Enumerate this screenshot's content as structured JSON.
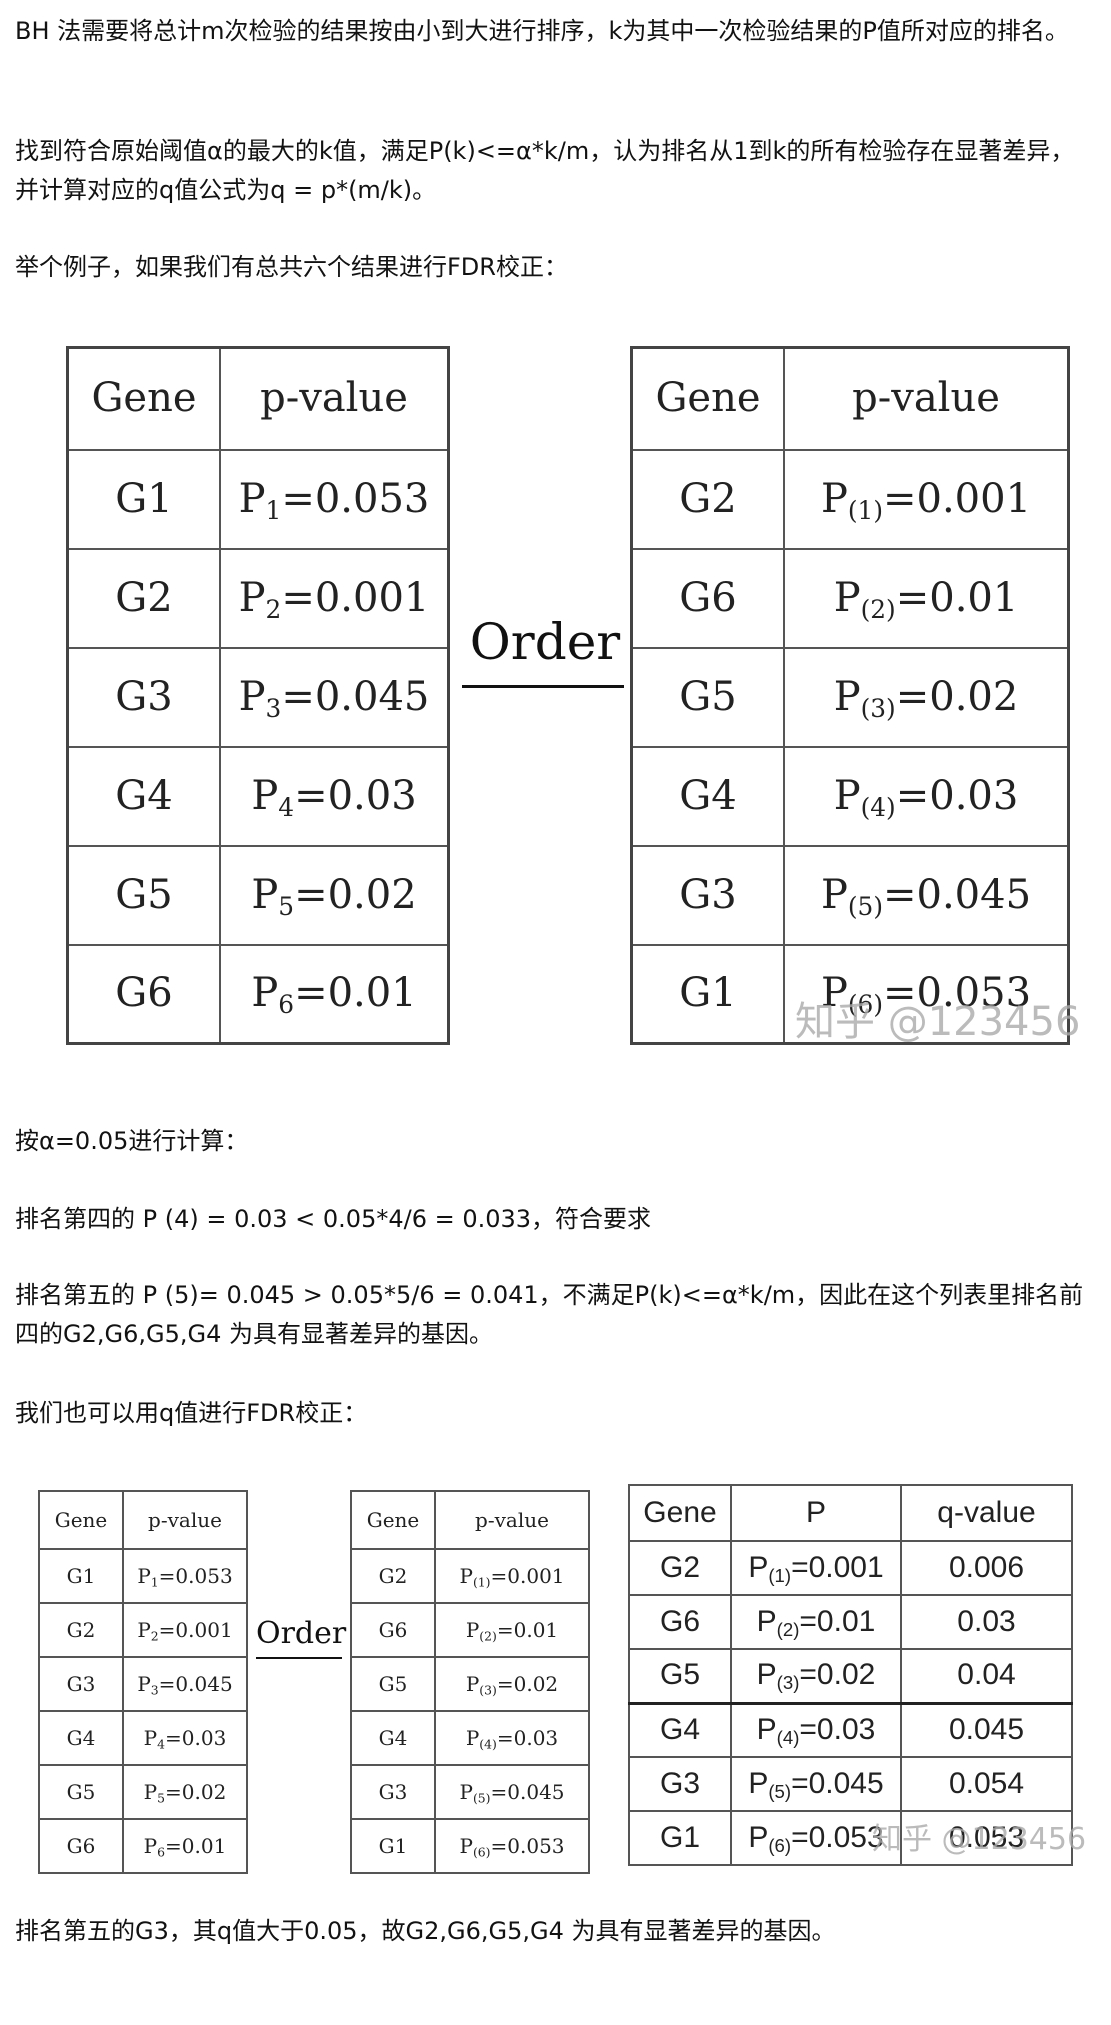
{
  "paragraphs": {
    "p1": "BH 法需要将总计m次检验的结果按由小到大进行排序，k为其中一次检验结果的P值所对应的排名。",
    "p2": "找到符合原始阈值α的最大的k值，满足P(k)<=α*k/m，认为排名从1到k的所有检验存在显著差异，并计算对应的q值公式为q = p*(m/k)。",
    "p3": "举个例子，如果我们有总共六个结果进行FDR校正：",
    "p4": "按α=0.05进行计算：",
    "p5": "排名第四的 P (4) = 0.03 < 0.05*4/6 = 0.033，符合要求",
    "p6": "排名第五的 P (5)= 0.045 > 0.05*5/6 = 0.041，不满足P(k)<=α*k/m，因此在这个列表里排名前四的G2,G6,G5,G4 为具有显著差异的基因。",
    "p7": "我们也可以用q值进行FDR校正：",
    "p8": "排名第五的G3，其q值大于0.05，故G2,G6,G5,G4 为具有显著差异的基因。"
  },
  "figure1": {
    "order_label": "Order",
    "watermark": "知乎 @123456",
    "original": {
      "headers": [
        "Gene",
        "p-value"
      ],
      "rows": [
        {
          "gene": "G1",
          "p": "P",
          "sub": "1",
          "value": "=0.053"
        },
        {
          "gene": "G2",
          "p": "P",
          "sub": "2",
          "value": "=0.001"
        },
        {
          "gene": "G3",
          "p": "P",
          "sub": "3",
          "value": "=0.045"
        },
        {
          "gene": "G4",
          "p": "P",
          "sub": "4",
          "value": "=0.03"
        },
        {
          "gene": "G5",
          "p": "P",
          "sub": "5",
          "value": "=0.02"
        },
        {
          "gene": "G6",
          "p": "P",
          "sub": "6",
          "value": "=0.01"
        }
      ]
    },
    "ordered": {
      "headers": [
        "Gene",
        "p-value"
      ],
      "rows": [
        {
          "gene": "G2",
          "p": "P",
          "sub": "(1)",
          "value": "=0.001"
        },
        {
          "gene": "G6",
          "p": "P",
          "sub": "(2)",
          "value": "=0.01"
        },
        {
          "gene": "G5",
          "p": "P",
          "sub": "(3)",
          "value": "=0.02"
        },
        {
          "gene": "G4",
          "p": "P",
          "sub": "(4)",
          "value": "=0.03"
        },
        {
          "gene": "G3",
          "p": "P",
          "sub": "(5)",
          "value": "=0.045"
        },
        {
          "gene": "G1",
          "p": "P",
          "sub": "(6)",
          "value": "=0.053"
        }
      ]
    }
  },
  "figure2": {
    "order_label": "Order",
    "watermark": "知乎 @123456",
    "original": {
      "headers": [
        "Gene",
        "p-value"
      ],
      "rows": [
        {
          "gene": "G1",
          "p": "P",
          "sub": "1",
          "value": "=0.053"
        },
        {
          "gene": "G2",
          "p": "P",
          "sub": "2",
          "value": "=0.001"
        },
        {
          "gene": "G3",
          "p": "P",
          "sub": "3",
          "value": "=0.045"
        },
        {
          "gene": "G4",
          "p": "P",
          "sub": "4",
          "value": "=0.03"
        },
        {
          "gene": "G5",
          "p": "P",
          "sub": "5",
          "value": "=0.02"
        },
        {
          "gene": "G6",
          "p": "P",
          "sub": "6",
          "value": "=0.01"
        }
      ]
    },
    "ordered": {
      "headers": [
        "Gene",
        "p-value"
      ],
      "rows": [
        {
          "gene": "G2",
          "p": "P",
          "sub": "(1)",
          "value": "=0.001"
        },
        {
          "gene": "G6",
          "p": "P",
          "sub": "(2)",
          "value": "=0.01"
        },
        {
          "gene": "G5",
          "p": "P",
          "sub": "(3)",
          "value": "=0.02"
        },
        {
          "gene": "G4",
          "p": "P",
          "sub": "(4)",
          "value": "=0.03"
        },
        {
          "gene": "G3",
          "p": "P",
          "sub": "(5)",
          "value": "=0.045"
        },
        {
          "gene": "G1",
          "p": "P",
          "sub": "(6)",
          "value": "=0.053"
        }
      ]
    },
    "qtable": {
      "headers": [
        "Gene",
        "P",
        "q-value"
      ],
      "rows": [
        {
          "gene": "G2",
          "p": "P",
          "sub": "(1)",
          "value": "=0.001",
          "q": "0.006"
        },
        {
          "gene": "G6",
          "p": "P",
          "sub": "(2)",
          "value": "=0.01",
          "q": "0.03"
        },
        {
          "gene": "G5",
          "p": "P",
          "sub": "(3)",
          "value": "=0.02",
          "q": "0.04"
        },
        {
          "gene": "G4",
          "p": "P",
          "sub": "(4)",
          "value": "=0.03",
          "q": "0.045"
        },
        {
          "gene": "G3",
          "p": "P",
          "sub": "(5)",
          "value": "=0.045",
          "q": "0.054"
        },
        {
          "gene": "G1",
          "p": "P",
          "sub": "(6)",
          "value": "=0.053",
          "q": "0.053"
        }
      ]
    }
  }
}
